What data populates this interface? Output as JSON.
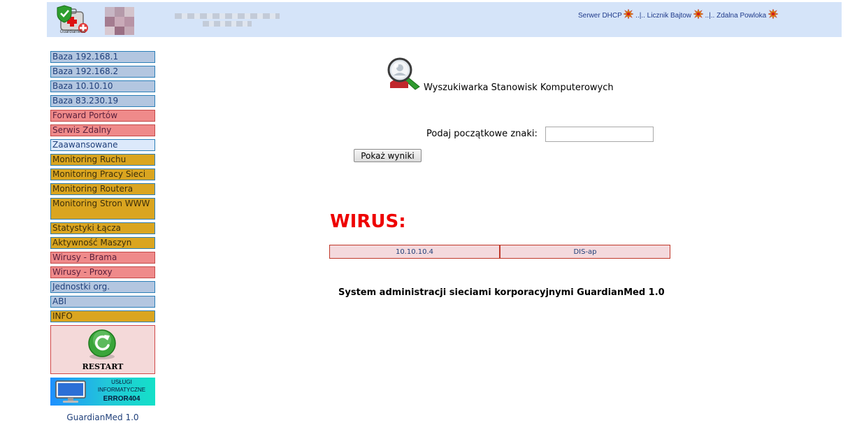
{
  "header": {
    "logo_caption": "GuardianMed",
    "topnav": [
      {
        "label": "Serwer DHCP",
        "icon": "burst-icon"
      },
      {
        "label": "Licznik Bajtow",
        "icon": "burst-icon"
      },
      {
        "label": "Zdalna Powloka",
        "icon": "burst-icon"
      }
    ],
    "separator": "..|.."
  },
  "sidebar": {
    "items": [
      {
        "label": "Baza 192.168.1",
        "color": "blue"
      },
      {
        "label": "Baza 192.168.2",
        "color": "blue"
      },
      {
        "label": "Baza 10.10.10",
        "color": "blue"
      },
      {
        "label": "Baza 83.230.19",
        "color": "blue"
      },
      {
        "label": "Forward Portów",
        "color": "red"
      },
      {
        "label": "Serwis Zdalny",
        "color": "red"
      },
      {
        "label": "Zaawansowane",
        "color": "light"
      },
      {
        "label": "Monitoring Ruchu",
        "color": "gold"
      },
      {
        "label": "Monitoring Pracy Sieci",
        "color": "gold"
      },
      {
        "label": "Monitoring Routera",
        "color": "gold"
      },
      {
        "label": "Monitoring Stron WWW",
        "color": "gold"
      },
      {
        "label": "Statystyki Łącza",
        "color": "gold"
      },
      {
        "label": "Aktywność Maszyn",
        "color": "gold"
      },
      {
        "label": "Wirusy - Brama",
        "color": "red"
      },
      {
        "label": "Wirusy - Proxy",
        "color": "red"
      },
      {
        "label": "Jednostki org.",
        "color": "blue"
      },
      {
        "label": "ABI",
        "color": "blue"
      },
      {
        "label": "INFO",
        "color": "gold"
      }
    ],
    "restart_label": "RESTART",
    "banner": {
      "line1": "USŁUGI",
      "line2": "INFORMATYCZNE",
      "line3": "ERROR404"
    },
    "version": "GuardianMed 1.0"
  },
  "main": {
    "search_title": "Wyszukiwarka Stanowisk Komputerowych",
    "search_label": "Podaj początkowe znaki:",
    "search_value": "",
    "show_button": "Pokaż wyniki",
    "virus_heading": "WIRUS:",
    "virus_row": {
      "ip": "10.10.10.4",
      "host": "DIS-ap"
    },
    "footer": "System administracji sieciami korporacyjnymi GuardianMed 1.0"
  },
  "colors": {
    "header_bg": "#d5e4f9",
    "nav_blue": "#b3c6e0",
    "nav_red": "#ef8a8a",
    "nav_gold": "#daa520",
    "virus_red": "#ee0000"
  }
}
